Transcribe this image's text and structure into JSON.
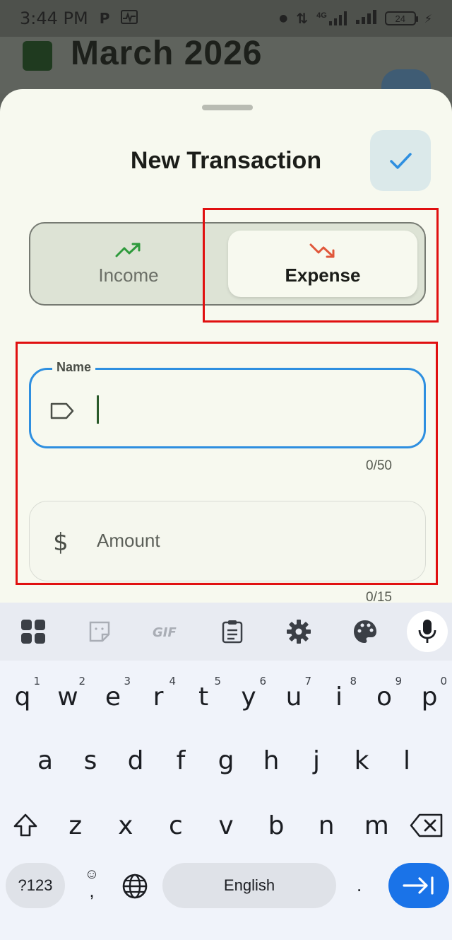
{
  "status_bar": {
    "time": "3:44 PM",
    "network": "4G",
    "battery": "24"
  },
  "background": {
    "title": "March 2026"
  },
  "sheet": {
    "title": "New Transaction",
    "type_toggle": {
      "income_label": "Income",
      "expense_label": "Expense",
      "selected": "Expense"
    },
    "name_field": {
      "label": "Name",
      "value": "",
      "counter": "0/50"
    },
    "amount_field": {
      "placeholder": "Amount",
      "counter": "0/15"
    }
  },
  "keyboard": {
    "row1": [
      {
        "k": "q",
        "n": "1"
      },
      {
        "k": "w",
        "n": "2"
      },
      {
        "k": "e",
        "n": "3"
      },
      {
        "k": "r",
        "n": "4"
      },
      {
        "k": "t",
        "n": "5"
      },
      {
        "k": "y",
        "n": "6"
      },
      {
        "k": "u",
        "n": "7"
      },
      {
        "k": "i",
        "n": "8"
      },
      {
        "k": "o",
        "n": "9"
      },
      {
        "k": "p",
        "n": "0"
      }
    ],
    "row2": [
      "a",
      "s",
      "d",
      "f",
      "g",
      "h",
      "j",
      "k",
      "l"
    ],
    "row3": [
      "z",
      "x",
      "c",
      "v",
      "b",
      "n",
      "m"
    ],
    "symbols_label": "?123",
    "space_label": "English",
    "comma": ",",
    "period": "."
  },
  "colors": {
    "accent_blue": "#2e8fe0",
    "income_green": "#2e9a3c",
    "expense_red": "#e0573a",
    "highlight": "#e01010"
  }
}
